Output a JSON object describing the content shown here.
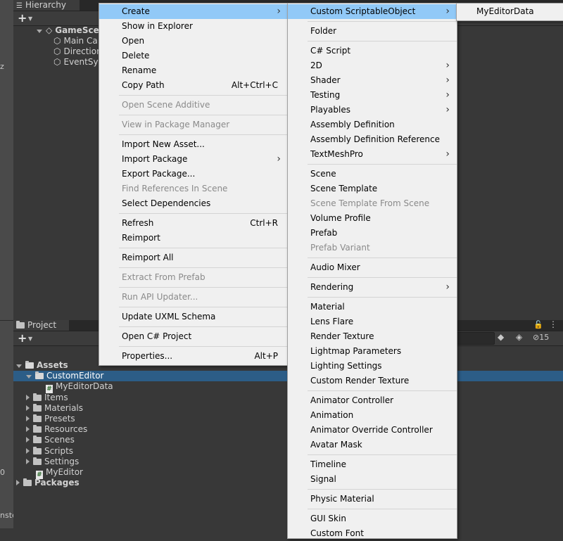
{
  "hierarchy": {
    "tab_label": "Hierarchy",
    "scene_name": "GameScen",
    "objects": [
      "Main Ca",
      "Direction",
      "EventSys"
    ]
  },
  "left_strip": {
    "z_label": "z",
    "zero_label": "0",
    "bottom_label": "nste"
  },
  "project": {
    "tab_label": "Project",
    "lock_label": "15",
    "tree": [
      {
        "label": "Assets",
        "level": 0,
        "type": "folder",
        "expanded": true
      },
      {
        "label": "CustomEditor",
        "level": 1,
        "type": "folder",
        "expanded": true,
        "selected": true
      },
      {
        "label": "MyEditorData",
        "level": 2,
        "type": "script"
      },
      {
        "label": "Items",
        "level": 1,
        "type": "folder"
      },
      {
        "label": "Materials",
        "level": 1,
        "type": "folder"
      },
      {
        "label": "Presets",
        "level": 1,
        "type": "folder"
      },
      {
        "label": "Resources",
        "level": 1,
        "type": "folder"
      },
      {
        "label": "Scenes",
        "level": 1,
        "type": "folder"
      },
      {
        "label": "Scripts",
        "level": 1,
        "type": "folder"
      },
      {
        "label": "Settings",
        "level": 1,
        "type": "folder"
      },
      {
        "label": "MyEditor",
        "level": 1,
        "type": "script"
      },
      {
        "label": "Packages",
        "level": 0,
        "type": "folder"
      }
    ]
  },
  "menu1": {
    "items": [
      {
        "label": "Create",
        "submenu": true,
        "highlight": true
      },
      {
        "label": "Show in Explorer"
      },
      {
        "label": "Open"
      },
      {
        "label": "Delete"
      },
      {
        "label": "Rename"
      },
      {
        "label": "Copy Path",
        "shortcut": "Alt+Ctrl+C"
      },
      {
        "sep": true
      },
      {
        "label": "Open Scene Additive",
        "disabled": true
      },
      {
        "sep": true
      },
      {
        "label": "View in Package Manager",
        "disabled": true
      },
      {
        "sep": true
      },
      {
        "label": "Import New Asset..."
      },
      {
        "label": "Import Package",
        "submenu": true
      },
      {
        "label": "Export Package..."
      },
      {
        "label": "Find References In Scene",
        "disabled": true
      },
      {
        "label": "Select Dependencies"
      },
      {
        "sep": true
      },
      {
        "label": "Refresh",
        "shortcut": "Ctrl+R"
      },
      {
        "label": "Reimport"
      },
      {
        "sep": true
      },
      {
        "label": "Reimport All"
      },
      {
        "sep": true
      },
      {
        "label": "Extract From Prefab",
        "disabled": true
      },
      {
        "sep": true
      },
      {
        "label": "Run API Updater...",
        "disabled": true
      },
      {
        "sep": true
      },
      {
        "label": "Update UXML Schema"
      },
      {
        "sep": true
      },
      {
        "label": "Open C# Project"
      },
      {
        "sep": true
      },
      {
        "label": "Properties...",
        "shortcut": "Alt+P"
      }
    ]
  },
  "menu2": {
    "items": [
      {
        "label": "Custom ScriptableObject",
        "submenu": true,
        "highlight": true
      },
      {
        "sep": true
      },
      {
        "label": "Folder"
      },
      {
        "sep": true
      },
      {
        "label": "C# Script"
      },
      {
        "label": "2D",
        "submenu": true
      },
      {
        "label": "Shader",
        "submenu": true
      },
      {
        "label": "Testing",
        "submenu": true
      },
      {
        "label": "Playables",
        "submenu": true
      },
      {
        "label": "Assembly Definition"
      },
      {
        "label": "Assembly Definition Reference"
      },
      {
        "label": "TextMeshPro",
        "submenu": true
      },
      {
        "sep": true
      },
      {
        "label": "Scene"
      },
      {
        "label": "Scene Template"
      },
      {
        "label": "Scene Template From Scene",
        "disabled": true
      },
      {
        "label": "Volume Profile"
      },
      {
        "label": "Prefab"
      },
      {
        "label": "Prefab Variant",
        "disabled": true
      },
      {
        "sep": true
      },
      {
        "label": "Audio Mixer"
      },
      {
        "sep": true
      },
      {
        "label": "Rendering",
        "submenu": true
      },
      {
        "sep": true
      },
      {
        "label": "Material"
      },
      {
        "label": "Lens Flare"
      },
      {
        "label": "Render Texture"
      },
      {
        "label": "Lightmap Parameters"
      },
      {
        "label": "Lighting Settings"
      },
      {
        "label": "Custom Render Texture"
      },
      {
        "sep": true
      },
      {
        "label": "Animator Controller"
      },
      {
        "label": "Animation"
      },
      {
        "label": "Animator Override Controller"
      },
      {
        "label": "Avatar Mask"
      },
      {
        "sep": true
      },
      {
        "label": "Timeline"
      },
      {
        "label": "Signal"
      },
      {
        "sep": true
      },
      {
        "label": "Physic Material"
      },
      {
        "sep": true
      },
      {
        "label": "GUI Skin"
      },
      {
        "label": "Custom Font"
      }
    ]
  },
  "menu3": {
    "items": [
      {
        "label": "MyEditorData"
      }
    ]
  }
}
